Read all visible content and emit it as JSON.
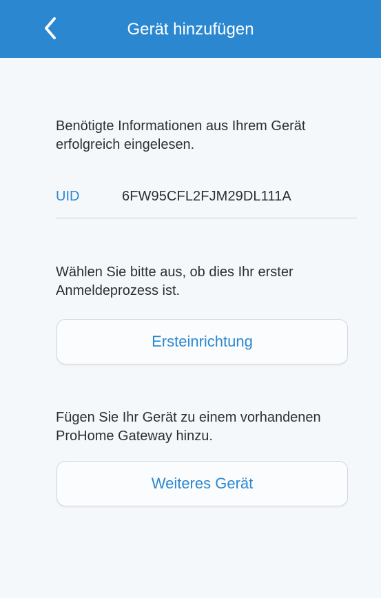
{
  "header": {
    "title": "Gerät hinzufügen",
    "back_icon": "chevron-left-icon"
  },
  "info": {
    "intro": "Benötigte Informationen aus Ihrem Gerät erfolgreich eingelesen.",
    "uid_label": "UID",
    "uid_value": "6FW95CFL2FJM29DL111A"
  },
  "setup": {
    "prompt": "Wählen Sie bitte aus, ob dies Ihr erster Anmeldeprozess ist.",
    "first_setup_button": "Ersteinrichtung"
  },
  "gateway": {
    "prompt": "Fügen Sie Ihr Gerät zu einem vorhandenen ProHome Gateway hinzu.",
    "additional_device_button": "Weiteres Gerät"
  },
  "colors": {
    "accent": "#2b88d0",
    "background": "#f4f8fb",
    "text": "#2b2f33"
  }
}
